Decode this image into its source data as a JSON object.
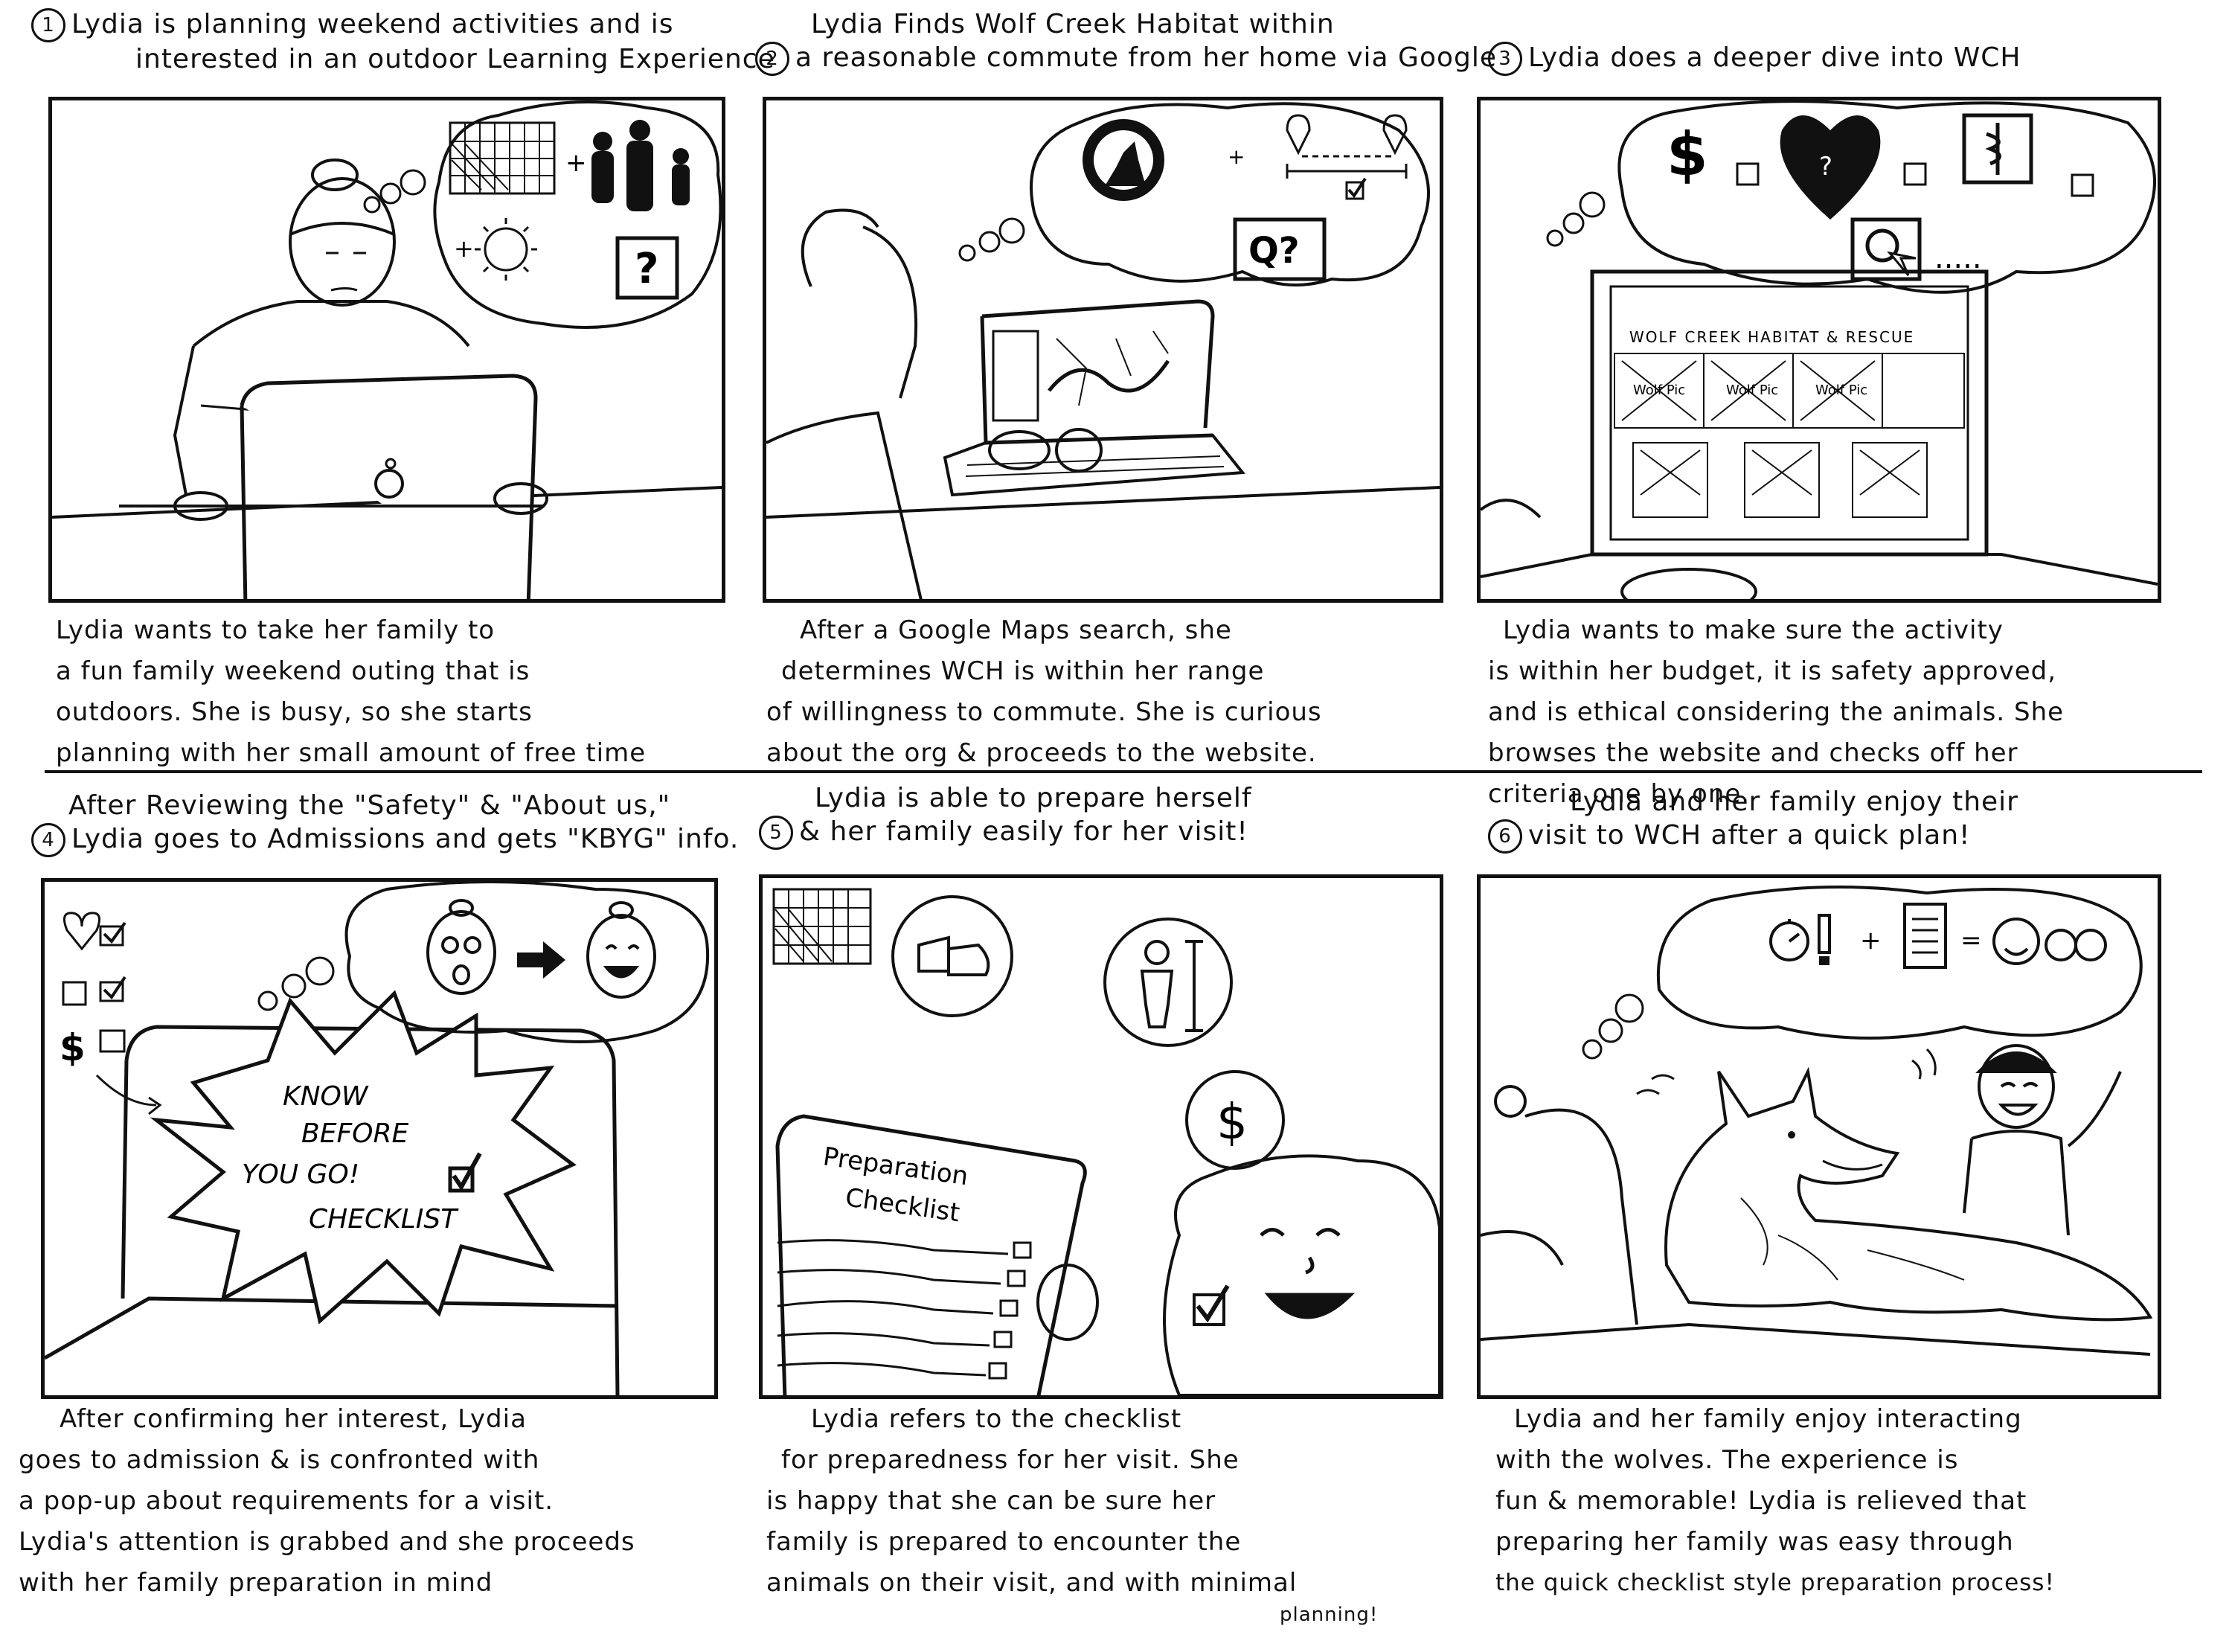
{
  "panels": [
    {
      "number": "1",
      "header": [
        "Lydia is planning weekend activities and is",
        "interested in an outdoor Learning Experience"
      ],
      "caption": [
        "Lydia wants to take her family to",
        "a fun family weekend outing that is",
        "outdoors. She is busy, so she starts",
        "planning with her small amount of free time"
      ]
    },
    {
      "number": "2",
      "header": [
        "Lydia Finds Wolf Creek Habitat within",
        "a reasonable commute from her home via Google"
      ],
      "caption": [
        "After a Google Maps search, she",
        "determines WCH is within her range",
        "of willingness to commute. She is curious",
        "about the org & proceeds to the website."
      ]
    },
    {
      "number": "3",
      "header": [
        "Lydia does a deeper dive into WCH"
      ],
      "caption": [
        "Lydia wants to make sure the activity",
        "is within her budget, it is safety approved,",
        "and is ethical considering the animals. She",
        "browses the website and checks off her",
        "criteria one by one."
      ]
    },
    {
      "number": "4",
      "header": [
        "After Reviewing the \"Safety\" & \"About us,\"",
        "Lydia goes to Admissions and gets \"KBYG\" info."
      ],
      "caption": [
        "After confirming her interest, Lydia",
        "goes to admission & is confronted with",
        "a pop-up about requirements for a visit.",
        "Lydia's attention is grabbed and she proceeds",
        "with her family preparation in mind"
      ]
    },
    {
      "number": "5",
      "header": [
        "Lydia is able to prepare herself",
        "& her family easily for her visit!"
      ],
      "caption": [
        "Lydia refers to the checklist",
        "for preparedness for her visit. She",
        "is happy that she can be sure her",
        "family is prepared to encounter the",
        "animals on their visit, and with minimal",
        "planning!"
      ]
    },
    {
      "number": "6",
      "header": [
        "Lydia and her family enjoy their",
        "visit to WCH after a quick plan!"
      ],
      "caption": [
        "Lydia and her family enjoy interacting",
        "with the wolves. The experience is",
        "fun & memorable! Lydia is relieved that",
        "preparing her family was easy through",
        "the quick checklist style preparation process!"
      ]
    }
  ],
  "drawings": {
    "p3_site_title": "WOLF CREEK HABITAT & RESCUE",
    "p3_wolf_pic": "Wolf Pic",
    "p4_popup": [
      "KNOW",
      "BEFORE",
      "YOU GO!",
      "CHECKLIST"
    ],
    "p5_checklist_title": [
      "Preparation",
      "Checklist"
    ],
    "q_mark": "Q?",
    "question": "?",
    "dollar": "$",
    "dots": "....."
  }
}
